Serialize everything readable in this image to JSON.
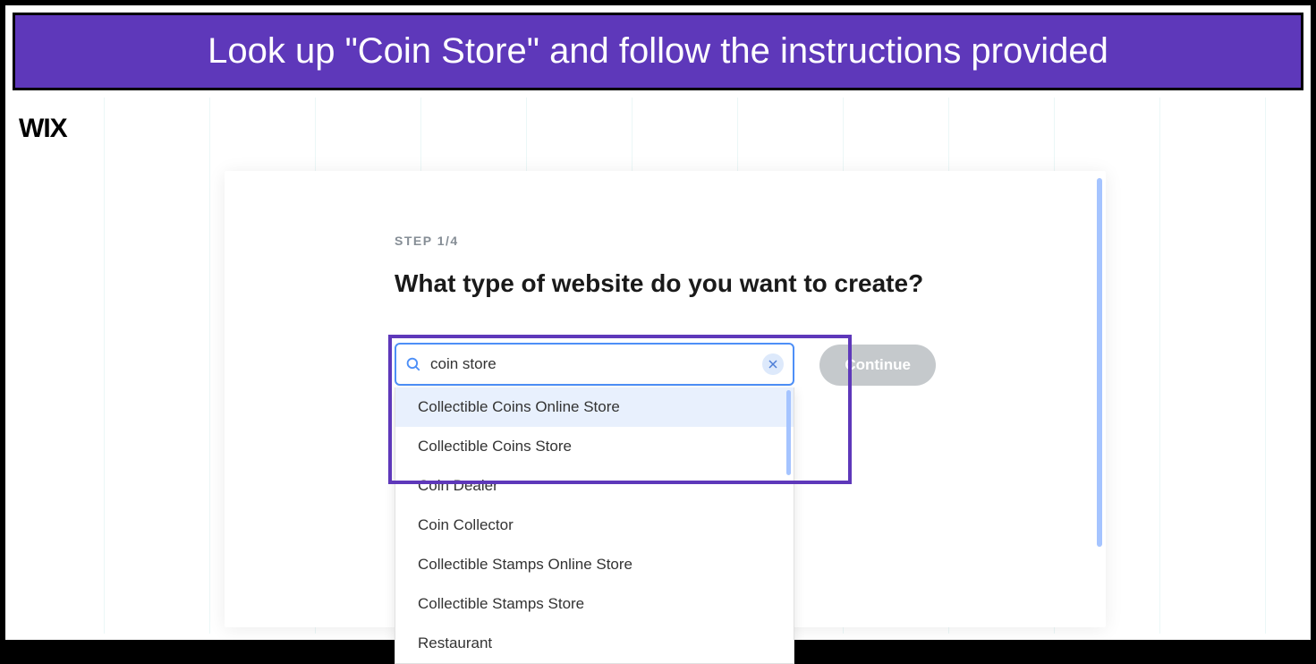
{
  "instruction": "Look up \"Coin Store\" and follow the instructions provided",
  "logo": "WIX",
  "step": "STEP 1/4",
  "heading": "What type of website do you want to create?",
  "search": {
    "value": "coin store",
    "placeholder": ""
  },
  "suggestions": [
    {
      "label": "Collectible Coins Online Store",
      "highlighted": true
    },
    {
      "label": "Collectible Coins Store",
      "highlighted": false
    },
    {
      "label": "Coin Dealer",
      "highlighted": false
    },
    {
      "label": "Coin Collector",
      "highlighted": false
    },
    {
      "label": "Collectible Stamps Online Store",
      "highlighted": false
    },
    {
      "label": "Collectible Stamps Store",
      "highlighted": false
    },
    {
      "label": "Restaurant",
      "highlighted": false
    }
  ],
  "continue_label": "Continue"
}
